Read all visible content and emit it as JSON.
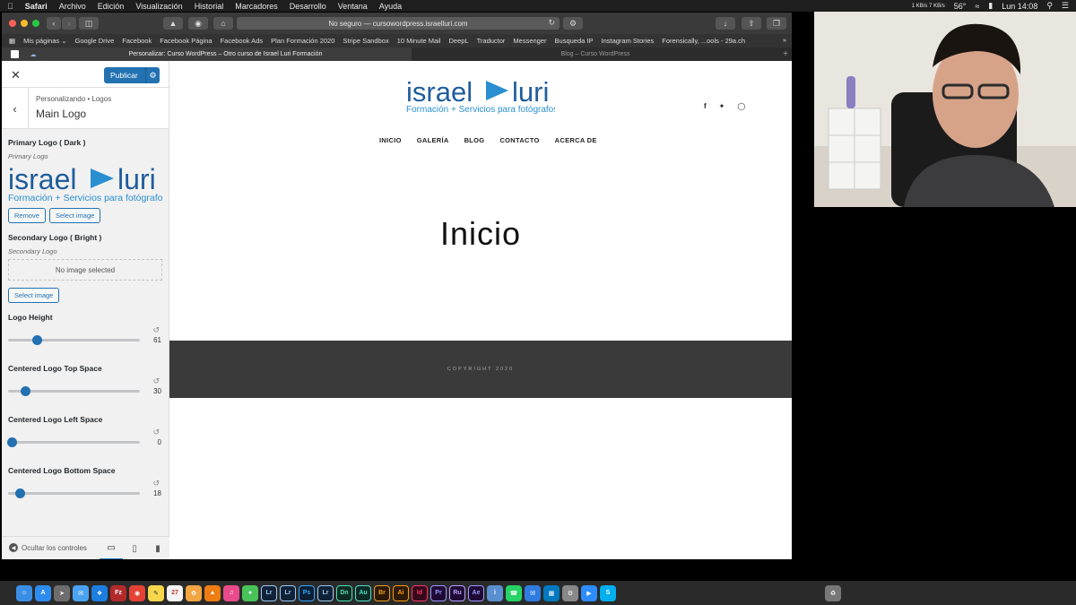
{
  "menubar": {
    "app": "Safari",
    "items": [
      "Archivo",
      "Edición",
      "Visualización",
      "Historial",
      "Marcadores",
      "Desarrollo",
      "Ventana",
      "Ayuda"
    ],
    "net": "1 KB/s 7 KB/s",
    "temp": "56°",
    "clock": "Lun 14:08"
  },
  "browser": {
    "url": "No seguro — cursowordpress.israelluri.com",
    "bookmarks": [
      "Mis páginas ⌄",
      "Google Drive",
      "Facebook",
      "Facebook Página",
      "Facebook Ads",
      "Plan Formación 2020",
      "Stripe Sandbox",
      "10 Minute Mail",
      "DeepL",
      "Traductor",
      "Messenger",
      "Busqueda IP",
      "Instagram Stories",
      "Forensically, ...ools - 29a.ch"
    ],
    "tabs": [
      {
        "title": "Personalizar: Curso WordPress – Otro curso de Israel Luri Formación",
        "active": true
      },
      {
        "title": "Blog – Curso WordPress",
        "active": false
      }
    ]
  },
  "customizer": {
    "publish": "Publicar",
    "breadcrumb": "Personalizando • Logos",
    "title": "Main Logo",
    "primary_logo": {
      "title": "Primary Logo ( Dark )",
      "desc": "Primary Logo",
      "remove": "Remove",
      "select": "Select image"
    },
    "secondary_logo": {
      "title": "Secondary Logo ( Bright )",
      "desc": "Secondary Logo",
      "placeholder": "No image selected",
      "select": "Select image"
    },
    "sliders": [
      {
        "label": "Logo Height",
        "value": 61,
        "fraction": 0.22
      },
      {
        "label": "Centered Logo Top Space",
        "value": 30,
        "fraction": 0.13
      },
      {
        "label": "Centered Logo Left Space",
        "value": 0,
        "fraction": 0.03
      },
      {
        "label": "Centered Logo Bottom Space",
        "value": 18,
        "fraction": 0.09
      }
    ],
    "hide_controls": "Ocultar los controles"
  },
  "logo": {
    "word1": "israel",
    "word2": "luri",
    "tagline": "Formación + Servicios para fotógrafos",
    "color": "#1f5d9b",
    "accent": "#2a8fd0"
  },
  "site": {
    "nav": [
      "INICIO",
      "GALERÍA",
      "BLOG",
      "CONTACTO",
      "ACERCA DE"
    ],
    "page_title": "Inicio",
    "copyright": "COPYRIGHT 2020"
  },
  "dock_apps": [
    "Finder",
    "App Store",
    "Launchpad",
    "Mail",
    "Safari",
    "FileZilla",
    "Chrome",
    "Notes",
    "Calendar",
    "Photos",
    "VLC",
    "iTunes",
    "Messages",
    "Lr",
    "Lr",
    "Ps",
    "Lr",
    "Dn",
    "Au",
    "Br",
    "Ai",
    "Id",
    "Pr",
    "Ru",
    "Ae",
    "Info",
    "WhatsApp",
    "Mail",
    "Trello",
    "Settings",
    "Zoom",
    "Skype",
    "Trash"
  ]
}
